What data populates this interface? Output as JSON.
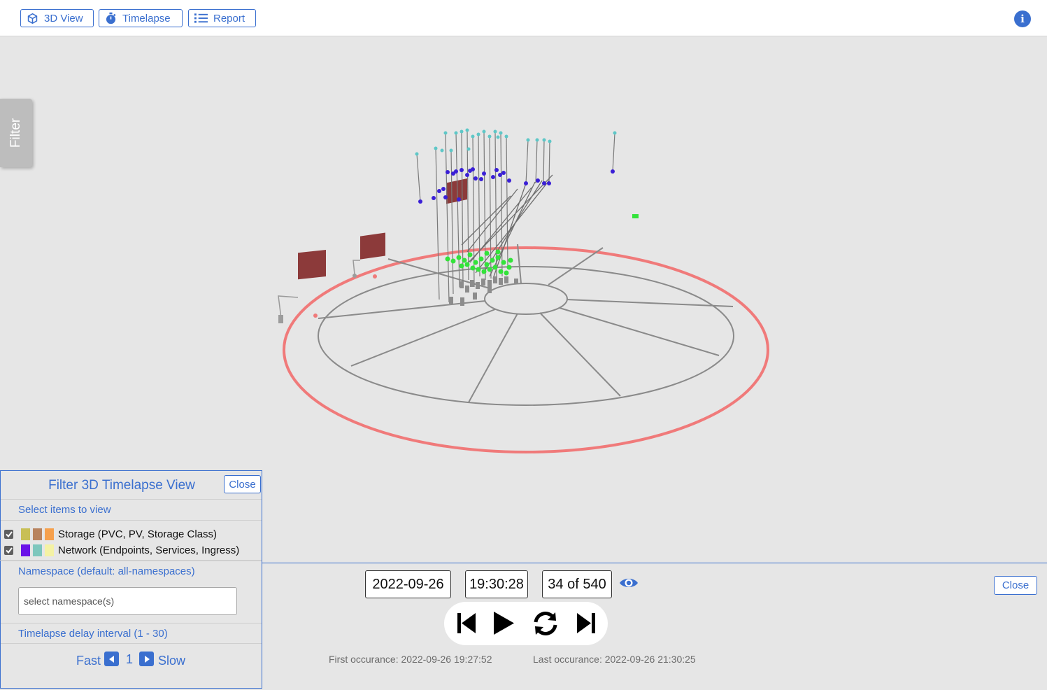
{
  "toolbar": {
    "view3d_label": "3D View",
    "timelapse_label": "Timelapse",
    "report_label": "Report",
    "info_glyph": "i"
  },
  "scene": {
    "filter_tab_label": "Filter"
  },
  "timelapse": {
    "date": "2022-09-26",
    "time": "19:30:28",
    "counter": "34 of 540",
    "first_occurrence": "First occurance: 2022-09-26 19:27:52",
    "last_occurrence": "Last occurance: 2022-09-26 21:30:25",
    "close_label": "Close",
    "controls": [
      "skip-back-icon",
      "play-icon",
      "loop-icon",
      "skip-forward-icon"
    ]
  },
  "filter_panel": {
    "title": "Filter 3D Timelapse View",
    "close_label": "Close",
    "select_items_heading": "Select items to view",
    "items": [
      {
        "label": "Storage (PVC, PV, Storage Class)",
        "checked": true,
        "swatches": [
          "#c8bf55",
          "#b8835e",
          "#f6a04c"
        ]
      },
      {
        "label": "Network (Endpoints, Services, Ingress)",
        "checked": true,
        "swatches": [
          "#6a13e8",
          "#7ec7bd",
          "#f4f2a4"
        ]
      }
    ],
    "namespace_heading": "Namespace (default: all-namespaces)",
    "namespace_placeholder": "select namespace(s)",
    "delay_heading": "Timelapse delay interval (1 - 30)",
    "delay_fast": "Fast",
    "delay_value": "1",
    "delay_slow": "Slow"
  },
  "colors": {
    "accent": "#3a6fcf",
    "ring": "#f07a7a",
    "pod_green": "#33e33a",
    "node_purple": "#3a1fd6",
    "node_teal": "#5ec7c7",
    "pv_block": "#8c3a3a"
  }
}
